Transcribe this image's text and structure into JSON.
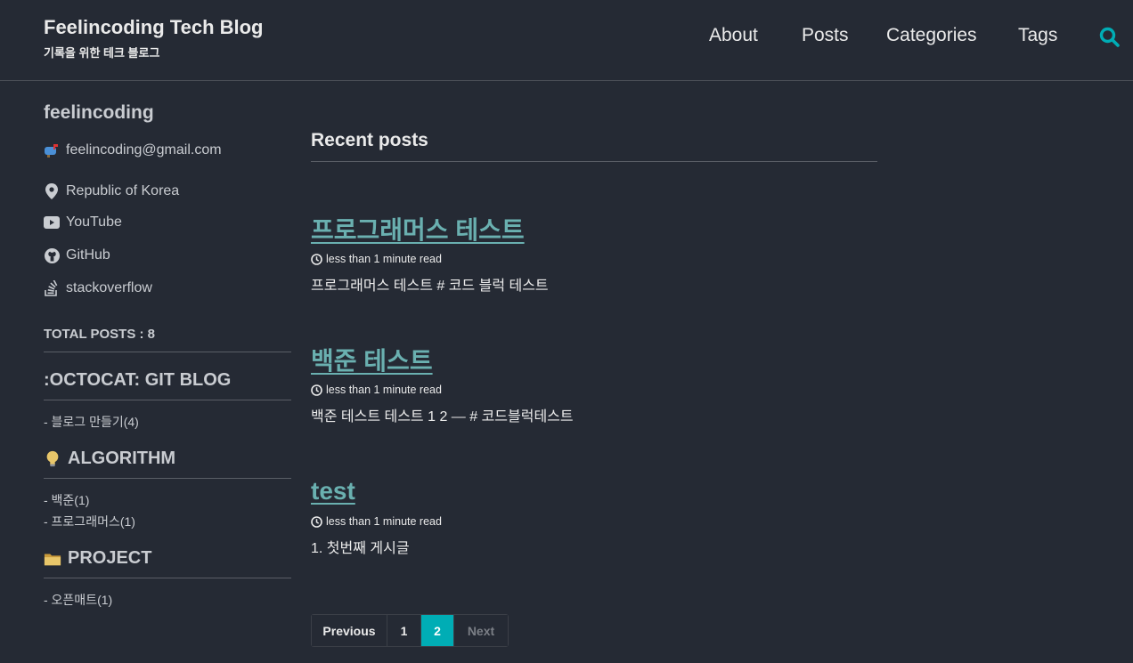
{
  "header": {
    "title": "Feelincoding Tech Blog",
    "subtitle": "기록을 위한 테크 블로그",
    "nav": [
      "About",
      "Posts",
      "Categories",
      "Tags"
    ],
    "search_icon": "search-icon",
    "accent": "#00adb5"
  },
  "sidebar": {
    "author": "feelincoding",
    "links": {
      "email": "feelincoding@gmail.com",
      "location": "Republic of Korea",
      "youtube": "YouTube",
      "github": "GitHub",
      "stackoverflow": "stackoverflow"
    },
    "total_posts": "TOTAL POSTS : 8",
    "categories": [
      {
        "title": ":OCTOCAT: GIT BLOG",
        "items": [
          "- 블로그 만들기(4)"
        ]
      },
      {
        "title": "ALGORITHM",
        "icon": "lightbulb-icon",
        "items": [
          "- 백준(1)",
          "- 프로그래머스(1)"
        ]
      },
      {
        "title": "PROJECT",
        "icon": "folder-icon",
        "items": [
          "- 오픈매트(1)"
        ]
      }
    ]
  },
  "main": {
    "section_title": "Recent posts",
    "posts": [
      {
        "title": "프로그래머스 테스트",
        "meta": "less than 1 minute read",
        "excerpt": "프로그래머스 테스트 # 코드 블럭 테스트"
      },
      {
        "title": "백준 테스트",
        "meta": "less than 1 minute read",
        "excerpt": "백준 테스트 테스트 1 2 — # 코드블럭테스트"
      },
      {
        "title": "test",
        "meta": "less than 1 minute read",
        "excerpt": "1. 첫번째 게시글"
      }
    ]
  },
  "pagination": {
    "previous": "Previous",
    "pages": [
      "1",
      "2"
    ],
    "current": "2",
    "next": "Next"
  },
  "colors": {
    "background": "#252a34",
    "link": "#6ab0b0",
    "text": "#eaeaea"
  }
}
